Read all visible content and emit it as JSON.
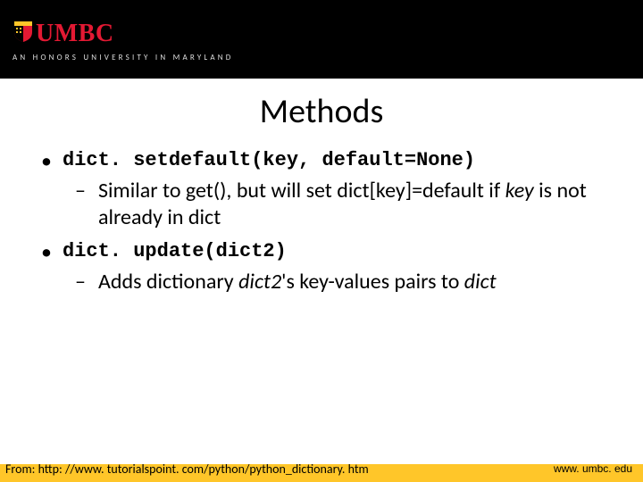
{
  "header": {
    "logo_text": "UMBC",
    "tagline": "AN HONORS UNIVERSITY IN MARYLAND"
  },
  "title": "Methods",
  "items": [
    {
      "code": "dict. setdefault(key, default=None)",
      "desc_pre": "Similar to get(), but will set dict[key]=default if ",
      "desc_ital": "key",
      "desc_post": " is not already in dict"
    },
    {
      "code": "dict. update(dict2)",
      "desc_pre": "Adds dictionary ",
      "desc_ital": "dict2",
      "desc_post": "'s key-values pairs to ",
      "desc_ital2": "dict"
    }
  ],
  "footer": {
    "from": "From: http: //www. tutorialspoint. com/python/python_dictionary. htm",
    "site": "www. umbc. edu"
  },
  "colors": {
    "brand_red": "#e31933",
    "brand_gold": "#ffc629"
  }
}
